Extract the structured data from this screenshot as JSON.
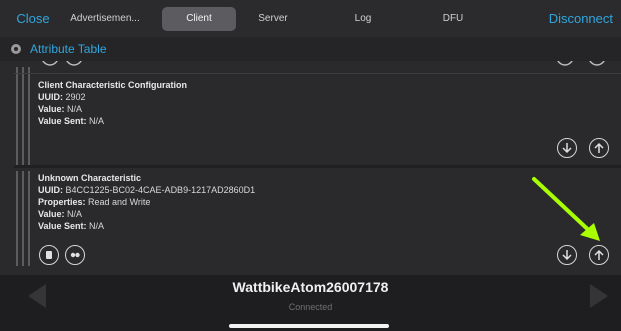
{
  "topbar": {
    "close_label": "Close",
    "tabs": [
      {
        "label": "Advertisemen..."
      },
      {
        "label": "Client"
      },
      {
        "label": "Server"
      },
      {
        "label": "Log"
      },
      {
        "label": "DFU"
      }
    ],
    "active_tab": "Client",
    "disconnect_label": "Disconnect"
  },
  "attribute_table": {
    "title": "Attribute Table"
  },
  "descriptor": {
    "name": "Client Characteristic Configuration",
    "uuid_label": "UUID:",
    "uuid": "2902",
    "value_label": "Value:",
    "value": "N/A",
    "value_sent_label": "Value Sent:",
    "value_sent": "N/A"
  },
  "characteristic": {
    "name": "Unknown Characteristic",
    "uuid_label": "UUID:",
    "uuid": "B4CC1225-BC02-4CAE-ADB9-1217AD2860D1",
    "properties_label": "Properties:",
    "properties": "Read and Write",
    "value_label": "Value:",
    "value": "N/A",
    "value_sent_label": "Value Sent:",
    "value_sent": "N/A"
  },
  "footer": {
    "device_name": "WattbikeAtom26007178",
    "status": "Connected"
  },
  "colors": {
    "accent": "#2fa6e0",
    "annotation_arrow": "#a8ff00"
  }
}
